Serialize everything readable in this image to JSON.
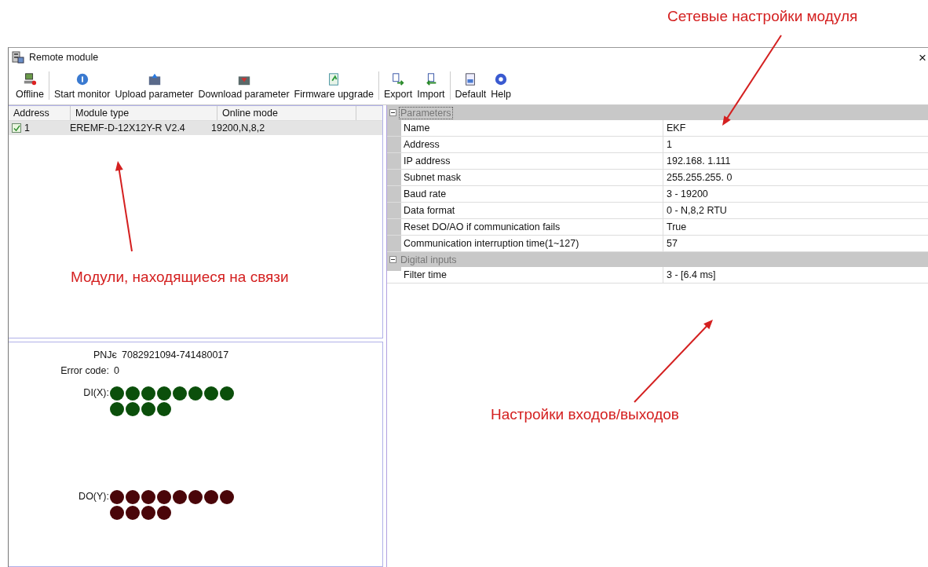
{
  "window": {
    "title": "Remote module",
    "close": "×"
  },
  "toolbar_groups": [
    [
      {
        "label": "Offline"
      }
    ],
    [
      {
        "label": "Start monitor"
      },
      {
        "label": "Upload parameter"
      },
      {
        "label": "Download parameter"
      },
      {
        "label": "Firmware upgrade"
      }
    ],
    [
      {
        "label": "Export"
      },
      {
        "label": "Import"
      }
    ],
    [
      {
        "label": "Default"
      },
      {
        "label": "Help"
      }
    ]
  ],
  "module_list": {
    "columns": [
      "Address",
      "Module type",
      "Online mode"
    ],
    "rows": [
      {
        "address": "1",
        "module_type": "EREMF-D-12X12Y-R V2.4",
        "online_mode": "19200,N,8,2",
        "checked": true,
        "selected": true
      }
    ]
  },
  "status": {
    "id_label": "PNJє",
    "id_value": "7082921094-741480017",
    "error_label": "Error code:",
    "error_value": "0",
    "io": [
      {
        "label": "DI(X):",
        "color": "#0b4f0b",
        "leds": [
          {
            "on": false
          },
          {
            "on": false
          },
          {
            "on": false
          },
          {
            "on": false
          },
          {
            "on": false
          },
          {
            "on": false
          },
          {
            "on": false
          },
          {
            "on": false
          },
          {
            "on": false
          },
          {
            "on": false
          },
          {
            "on": false
          },
          {
            "on": false
          }
        ]
      },
      {
        "label": "DO(Y):",
        "color": "#4a0509",
        "leds": [
          {
            "on": false
          },
          {
            "on": false
          },
          {
            "on": false
          },
          {
            "on": false
          },
          {
            "on": false
          },
          {
            "on": false
          },
          {
            "on": false
          },
          {
            "on": false
          },
          {
            "on": false
          },
          {
            "on": false
          },
          {
            "on": false
          },
          {
            "on": false
          }
        ]
      }
    ]
  },
  "property_grid": [
    {
      "category": "Parameters",
      "expanded": true,
      "selected": true,
      "rows": [
        {
          "name": "Name",
          "value": "EKF"
        },
        {
          "name": "Address",
          "value": "1"
        },
        {
          "name": "IP address",
          "value": "192.168.  1.111"
        },
        {
          "name": "Subnet mask",
          "value": "255.255.255.  0"
        },
        {
          "name": "Baud rate",
          "value": "3 - 19200"
        },
        {
          "name": "Data format",
          "value": "0 - N,8,2 RTU"
        },
        {
          "name": "Reset DO/AO if communication fails",
          "value": "True"
        },
        {
          "name": "Communication interruption time(1~127)",
          "value": "57"
        }
      ]
    },
    {
      "category": "Digital inputs",
      "expanded": true,
      "selected": false,
      "rows": [
        {
          "name": "Filter time",
          "value": "3 - [6.4 ms]"
        }
      ]
    }
  ],
  "annotations": [
    {
      "text": "Сетевые настройки модуля"
    },
    {
      "text": "Модули, находящиеся на связи"
    },
    {
      "text": "Настройки входов/выходов"
    }
  ]
}
